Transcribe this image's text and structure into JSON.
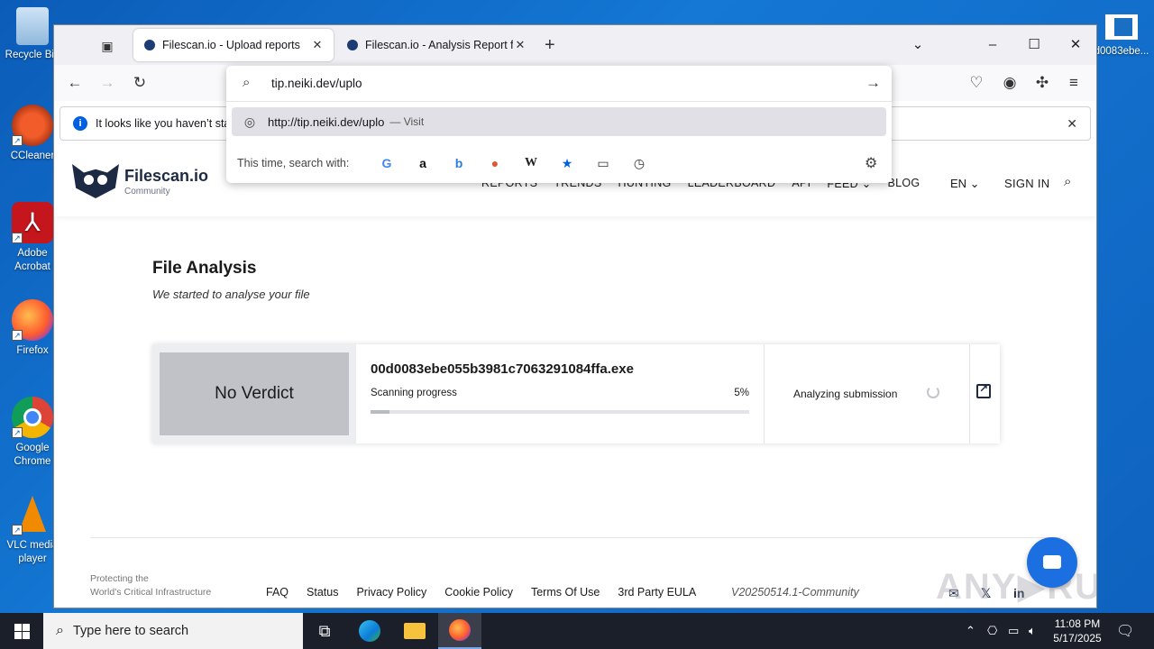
{
  "desktop": {
    "icons": [
      {
        "label": "Recycle Bin",
        "name": "recycle-bin-icon"
      },
      {
        "label": "CCleaner",
        "name": "ccleaner-icon"
      },
      {
        "label": "Adobe Acrobat",
        "name": "adobe-acrobat-icon"
      },
      {
        "label": "Firefox",
        "name": "firefox-icon"
      },
      {
        "label": "Google Chrome",
        "name": "chrome-icon"
      },
      {
        "label": "VLC media player",
        "name": "vlc-icon"
      }
    ],
    "right_icon_label": "d0083ebe..."
  },
  "browser": {
    "tabs": [
      {
        "title": "Filescan.io - Upload reports",
        "active": true
      },
      {
        "title": "Filescan.io - Analysis Report for",
        "active": false
      }
    ],
    "notification": "It looks like you haven’t star",
    "urlbar": {
      "typed": "tip.neiki.dev/uplo",
      "suggestion_url": "http://tip.neiki.dev/uplo",
      "suggestion_action": "— Visit",
      "search_with": "This time, search with:",
      "engines": [
        {
          "name": "google",
          "glyph": "G",
          "color": "#4285f4"
        },
        {
          "name": "amazon",
          "glyph": "a",
          "color": "#111111"
        },
        {
          "name": "bing",
          "glyph": "b",
          "color": "#2a7de1"
        },
        {
          "name": "duckduckgo",
          "glyph": "●",
          "color": "#de5833"
        },
        {
          "name": "wikipedia",
          "glyph": "W",
          "color": "#222222"
        },
        {
          "name": "bookmarks",
          "glyph": "★",
          "color": "#0060df"
        },
        {
          "name": "tabs",
          "glyph": "▭",
          "color": "#333333"
        },
        {
          "name": "history",
          "glyph": "◷",
          "color": "#333333"
        }
      ]
    }
  },
  "site": {
    "brand": "Filescan.io",
    "brand_sub": "Community",
    "nav": [
      "REPORTS",
      "TRENDS",
      "HUNTING",
      "LEADERBOARD",
      "API",
      "FEED ⌄",
      "BLOG"
    ],
    "lang": "EN ⌄",
    "signin": "SIGN IN",
    "title": "File Analysis",
    "subtitle": "We started to analyse your file",
    "card": {
      "verdict": "No Verdict",
      "filename": "00d0083ebe055b3981c7063291084ffa.exe",
      "progress_label": "Scanning progress",
      "progress_text": "5%",
      "progress_value": 0.05,
      "status": "Analyzing submission"
    },
    "footer": {
      "tagline_1": "Protecting the",
      "tagline_2": "World's Critical Infrastructure",
      "links": [
        "FAQ",
        "Status",
        "Privacy Policy",
        "Cookie Policy",
        "Terms Of Use",
        "3rd Party EULA"
      ],
      "version": "V20250514.1-Community"
    },
    "watermark": "ANY▶RUN"
  },
  "taskbar": {
    "search_placeholder": "Type here to search",
    "time": "11:08 PM",
    "date": "5/17/2025"
  }
}
